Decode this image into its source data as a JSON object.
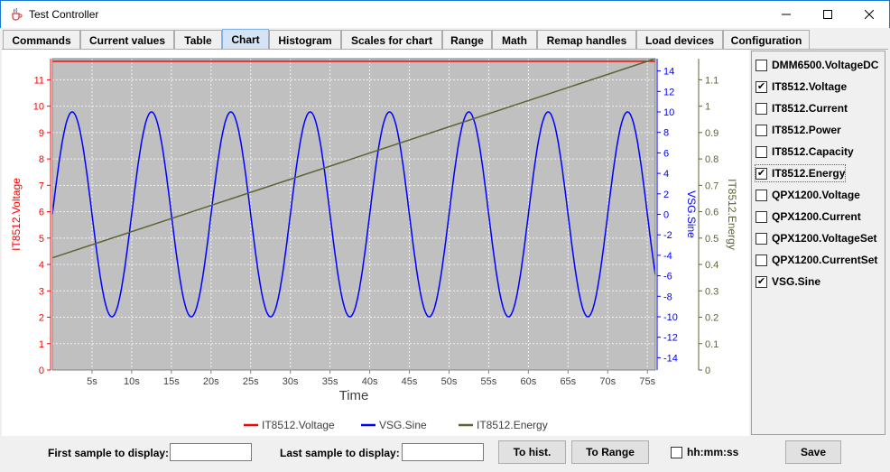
{
  "window": {
    "title": "Test Controller",
    "minimize_icon": "minimize-icon",
    "maximize_icon": "maximize-icon",
    "close_icon": "close-icon",
    "app_icon": "java-cup-icon"
  },
  "tabs": [
    {
      "label": "Commands",
      "active": false
    },
    {
      "label": "Current values",
      "active": false
    },
    {
      "label": "Table",
      "active": false
    },
    {
      "label": "Chart",
      "active": true
    },
    {
      "label": "Histogram",
      "active": false
    },
    {
      "label": "Scales for chart",
      "active": false
    },
    {
      "label": "Range",
      "active": false
    },
    {
      "label": "Math",
      "active": false
    },
    {
      "label": "Remap handles",
      "active": false
    },
    {
      "label": "Load devices",
      "active": false
    },
    {
      "label": "Configuration",
      "active": false
    }
  ],
  "chart_data": {
    "type": "line",
    "xlabel": "Time",
    "x_ticks": [
      "5s",
      "10s",
      "15s",
      "20s",
      "25s",
      "30s",
      "35s",
      "40s",
      "45s",
      "50s",
      "55s",
      "60s",
      "65s",
      "70s",
      "75s"
    ],
    "xlim": [
      0,
      76
    ],
    "plot_background": "#c0c0c0",
    "grid": true,
    "legend": "bottom",
    "axes": [
      {
        "id": "voltage",
        "label": "IT8512.Voltage",
        "side": "left",
        "color": "#ff0000",
        "ylim": [
          0,
          11.8
        ],
        "ticks": [
          "0",
          "1",
          "2",
          "3",
          "4",
          "5",
          "6",
          "7",
          "8",
          "9",
          "10",
          "11"
        ]
      },
      {
        "id": "sine",
        "label": "VSG.Sine",
        "side": "right",
        "color": "#0000ff",
        "ylim": [
          -15.2,
          15.2
        ],
        "ticks": [
          "-14",
          "-12",
          "-10",
          "-8",
          "-6",
          "-4",
          "-2",
          "0",
          "2",
          "4",
          "6",
          "8",
          "10",
          "12",
          "14"
        ]
      },
      {
        "id": "energy",
        "label": "IT8512.Energy",
        "side": "right",
        "color": "#5c6435",
        "ylim": [
          0,
          1.18
        ],
        "ticks": [
          "0",
          "0.1",
          "0.2",
          "0.3",
          "0.4",
          "0.5",
          "0.6",
          "0.7",
          "0.8",
          "0.9",
          "1",
          "1.1"
        ]
      }
    ],
    "series": [
      {
        "name": "IT8512.Voltage",
        "axis": "voltage",
        "color": "#ff0000",
        "kind": "constant",
        "value": 11.7
      },
      {
        "name": "VSG.Sine",
        "axis": "sine",
        "color": "#0000ff",
        "kind": "sine",
        "amplitude": 10,
        "period_s": 10,
        "phase_start_s": 0
      },
      {
        "name": "IT8512.Energy",
        "axis": "energy",
        "color": "#5c6435",
        "kind": "linear",
        "x": [
          0,
          76
        ],
        "y": [
          0.425,
          1.18
        ]
      }
    ]
  },
  "series_list": [
    {
      "label": "DMM6500.VoltageDC",
      "checked": false,
      "focused": false
    },
    {
      "label": "IT8512.Voltage",
      "checked": true,
      "focused": false
    },
    {
      "label": "IT8512.Current",
      "checked": false,
      "focused": false
    },
    {
      "label": "IT8512.Power",
      "checked": false,
      "focused": false
    },
    {
      "label": "IT8512.Capacity",
      "checked": false,
      "focused": false
    },
    {
      "label": "IT8512.Energy",
      "checked": true,
      "focused": true
    },
    {
      "label": "QPX1200.Voltage",
      "checked": false,
      "focused": false
    },
    {
      "label": "QPX1200.Current",
      "checked": false,
      "focused": false
    },
    {
      "label": "QPX1200.VoltageSet",
      "checked": false,
      "focused": false
    },
    {
      "label": "QPX1200.CurrentSet",
      "checked": false,
      "focused": false
    },
    {
      "label": "VSG.Sine",
      "checked": true,
      "focused": false
    }
  ],
  "bottom": {
    "first_sample_label": "First sample to display:",
    "first_sample_value": "",
    "last_sample_label": "Last sample to display:",
    "last_sample_value": "",
    "to_hist_label": "To hist.",
    "to_range_label": "To Range",
    "hhmmss_label": "hh:mm:ss",
    "hhmmss_checked": false,
    "save_label": "Save"
  }
}
